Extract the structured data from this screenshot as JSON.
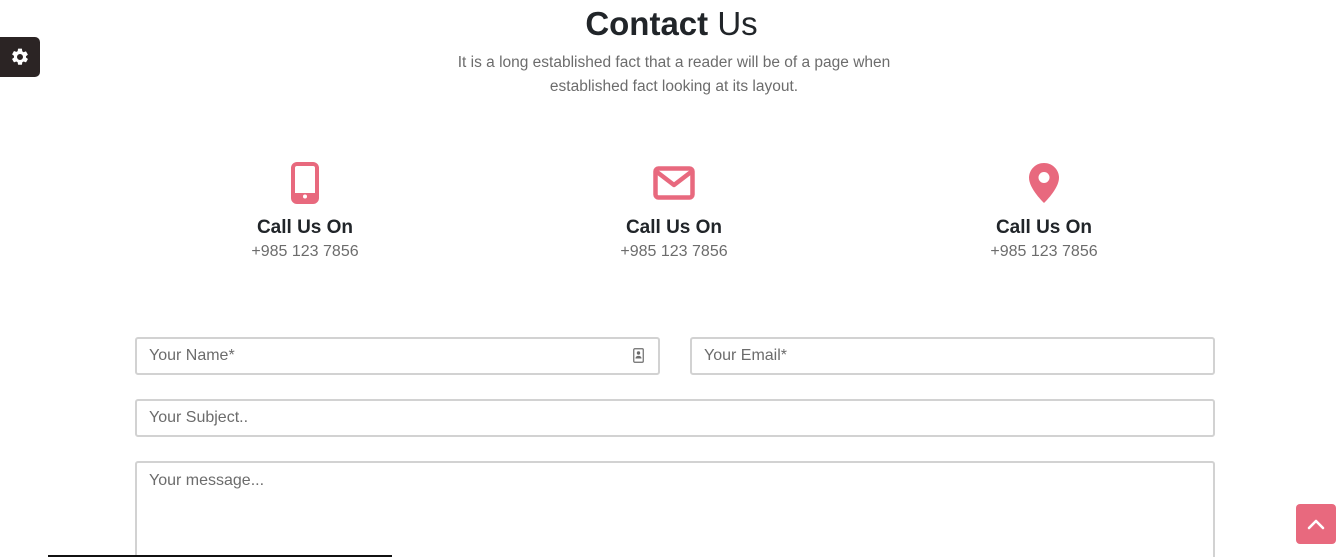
{
  "header": {
    "title_bold": "Contact",
    "title_light": "Us",
    "subtitle": "It is a long established fact that a reader will be of a page when established fact looking at its layout."
  },
  "contact_items": [
    {
      "icon": "mobile-phone-icon",
      "label": "Call Us On",
      "value": "+985 123 7856"
    },
    {
      "icon": "envelope-icon",
      "label": "Call Us On",
      "value": "+985 123 7856"
    },
    {
      "icon": "map-pin-icon",
      "label": "Call Us On",
      "value": "+985 123 7856"
    }
  ],
  "form": {
    "name_placeholder": "Your Name*",
    "email_placeholder": "Your Email*",
    "subject_placeholder": "Your Subject..",
    "message_placeholder": "Your message..."
  },
  "colors": {
    "accent": "#e8697e",
    "settings_bg": "#2b2424",
    "muted_text": "#6c6c6c",
    "heading_text": "#212529",
    "field_border": "#d2d2d2"
  },
  "icons": {
    "settings": "gear-icon",
    "back_to_top": "chevron-up-icon",
    "name_field": "contact-card-icon"
  }
}
